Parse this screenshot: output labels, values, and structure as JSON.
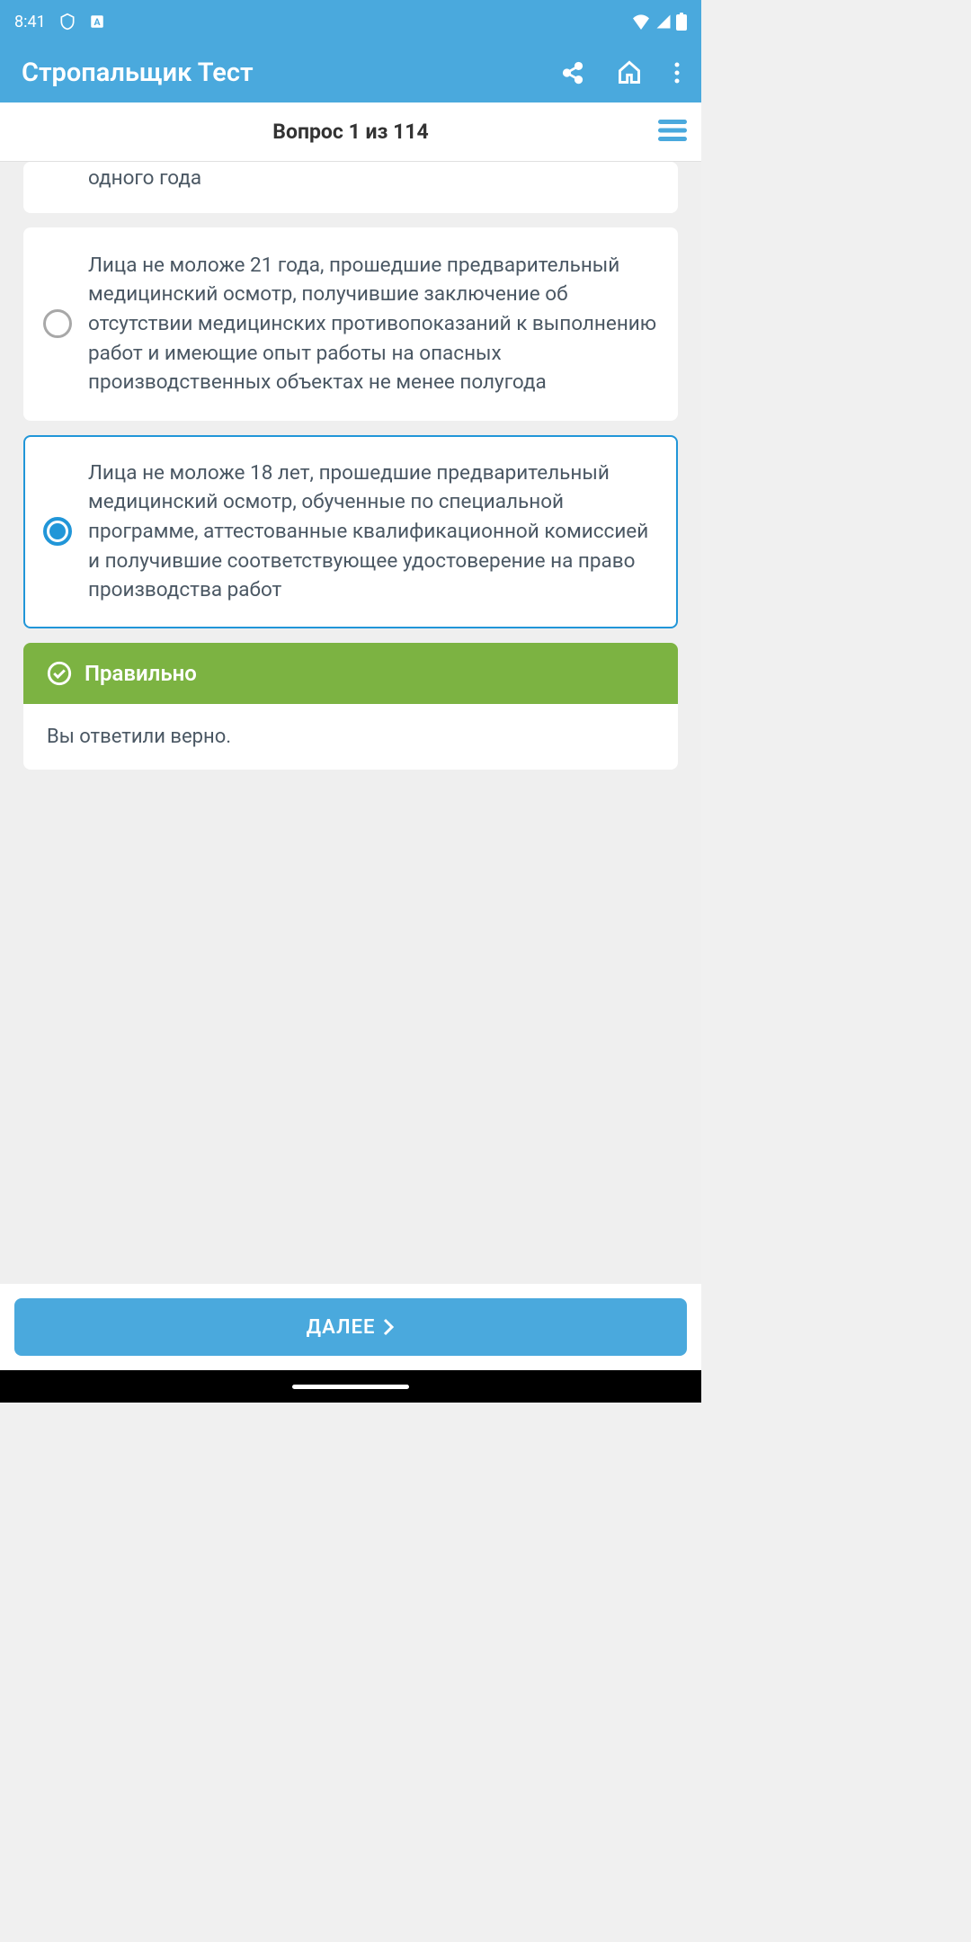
{
  "status": {
    "time": "8:41"
  },
  "header": {
    "title": "Стропальщик Тест"
  },
  "question": {
    "header": "Вопрос 1 из 114"
  },
  "answers": {
    "partial": "одного года",
    "option2": "Лица не моложе 21 года, прошедшие предварительный медицинский осмотр, получившие заключение об отсутствии медицинских противопоказаний к выполнению работ и имеющие опыт работы на опасных производственных объектах не менее полугода",
    "option3": "Лица не моложе 18 лет, прошедшие предварительный медицинский осмотр, обученные по специальной программе, аттестованные квалификационной комиссией и получившие соответствующее удостоверение на право производства работ"
  },
  "result": {
    "title": "Правильно",
    "body": "Вы ответили верно."
  },
  "footer": {
    "next": "ДАЛЕЕ"
  }
}
